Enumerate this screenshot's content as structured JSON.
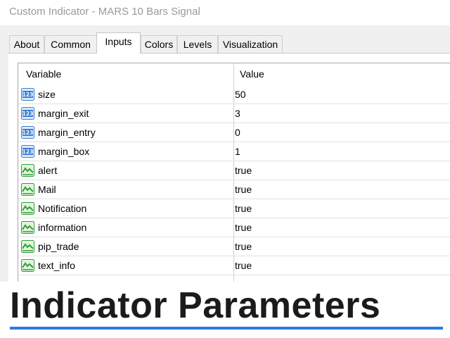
{
  "window": {
    "title": "Custom Indicator - MARS 10 Bars Signal"
  },
  "tabs": [
    {
      "label": "About"
    },
    {
      "label": "Common"
    },
    {
      "label": "Inputs"
    },
    {
      "label": "Colors"
    },
    {
      "label": "Levels"
    },
    {
      "label": "Visualization"
    }
  ],
  "active_tab": "Inputs",
  "table": {
    "headers": {
      "variable": "Variable",
      "value": "Value"
    },
    "rows": [
      {
        "name": "size",
        "value": "50",
        "type_icon": "integer-icon"
      },
      {
        "name": "margin_exit",
        "value": "3",
        "type_icon": "integer-icon"
      },
      {
        "name": "margin_entry",
        "value": "0",
        "type_icon": "integer-icon"
      },
      {
        "name": "margin_box",
        "value": "1",
        "type_icon": "integer-icon"
      },
      {
        "name": "alert",
        "value": "true",
        "type_icon": "boolean-icon"
      },
      {
        "name": "Mail",
        "value": "true",
        "type_icon": "boolean-icon"
      },
      {
        "name": "Notification",
        "value": "true",
        "type_icon": "boolean-icon"
      },
      {
        "name": "information",
        "value": "true",
        "type_icon": "boolean-icon"
      },
      {
        "name": "pip_trade",
        "value": "true",
        "type_icon": "boolean-icon"
      },
      {
        "name": "text_info",
        "value": "true",
        "type_icon": "boolean-icon"
      }
    ]
  },
  "banner": {
    "text": "Indicator Parameters"
  },
  "colors": {
    "integer_icon": "#3b7fd4",
    "boolean_icon": "#2e9e3a",
    "banner_underline": "#2a7be0"
  }
}
